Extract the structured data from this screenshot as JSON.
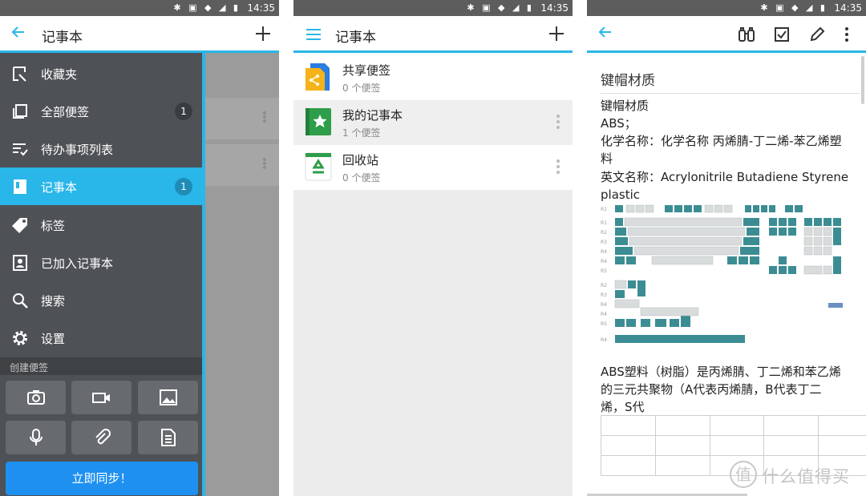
{
  "status": {
    "time": "14:35",
    "icons": "✱ ▣ ◆ ◢ ▮"
  },
  "panel1": {
    "title": "记事本",
    "drawer": [
      {
        "label": "收藏夹",
        "icon": "favorites-icon"
      },
      {
        "label": "全部便签",
        "icon": "all-notes-icon",
        "badge": "1"
      },
      {
        "label": "待办事项列表",
        "icon": "todo-list-icon"
      },
      {
        "label": "记事本",
        "icon": "notebook-icon",
        "badge": "1",
        "active": true
      },
      {
        "label": "标签",
        "icon": "tag-icon"
      },
      {
        "label": "已加入记事本",
        "icon": "joined-notebook-icon"
      },
      {
        "label": "搜索",
        "icon": "search-icon"
      },
      {
        "label": "设置",
        "icon": "gear-icon"
      }
    ],
    "create_header": "创建便签",
    "sync_label": "立即同步！"
  },
  "panel2": {
    "title": "记事本",
    "notebooks": [
      {
        "name": "共享便签",
        "count": "0 个便签"
      },
      {
        "name": "我的记事本",
        "count": "1 个便签"
      },
      {
        "name": "回收站",
        "count": "0 个便签"
      }
    ]
  },
  "panel3": {
    "note_title": "键帽材质",
    "lines": [
      "键帽材质",
      "ABS；",
      "化学名称：化学名称 丙烯腈-丁二烯-苯乙烯塑",
      "料",
      "英文名称：Acrylonitrile Butadiene Styrene",
      "plastic"
    ],
    "lines2": [
      "ABS塑料（树脂）是丙烯腈、丁二烯和苯乙烯",
      "的三元共聚物（A代表丙烯腈，B代表丁二",
      "烯，S代"
    ],
    "watermark_symbol": "值",
    "watermark_text": "什么值得买"
  },
  "colors": {
    "accent": "#29b6e8",
    "drawer": "#4e5256",
    "sync": "#1e90f0"
  }
}
